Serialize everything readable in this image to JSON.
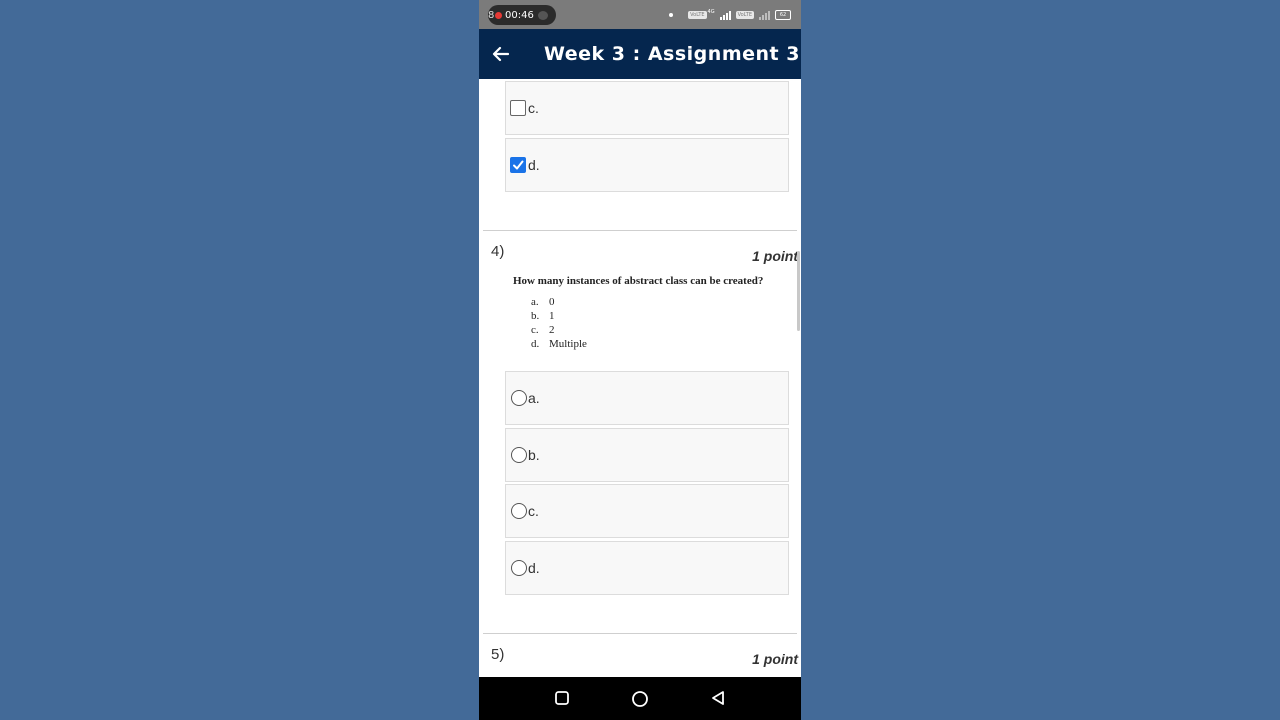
{
  "status_bar": {
    "lead_char": "8",
    "recording_time": "00:46",
    "volte1": "VoLTE",
    "net_type": "4G",
    "volte2": "VoLTE",
    "battery": "62"
  },
  "app_bar": {
    "title": "Week 3 : Assignment 3"
  },
  "prev_question": {
    "options": [
      {
        "label": "c.",
        "checked": false
      },
      {
        "label": "d.",
        "checked": true
      }
    ]
  },
  "question4": {
    "number": "4)",
    "points": "1 point",
    "text": "How many instances of abstract class can be created?",
    "choices": [
      {
        "key": "a.",
        "value": "0"
      },
      {
        "key": "b.",
        "value": "1"
      },
      {
        "key": "c.",
        "value": "2"
      },
      {
        "key": "d.",
        "value": "Multiple"
      }
    ],
    "options": [
      {
        "label": "a."
      },
      {
        "label": "b."
      },
      {
        "label": "c."
      },
      {
        "label": "d."
      }
    ]
  },
  "question5": {
    "number": "5)",
    "points": "1 point"
  },
  "colors": {
    "background": "#436a98",
    "app_bar": "#05264e",
    "checkbox_checked": "#1a73e8"
  }
}
